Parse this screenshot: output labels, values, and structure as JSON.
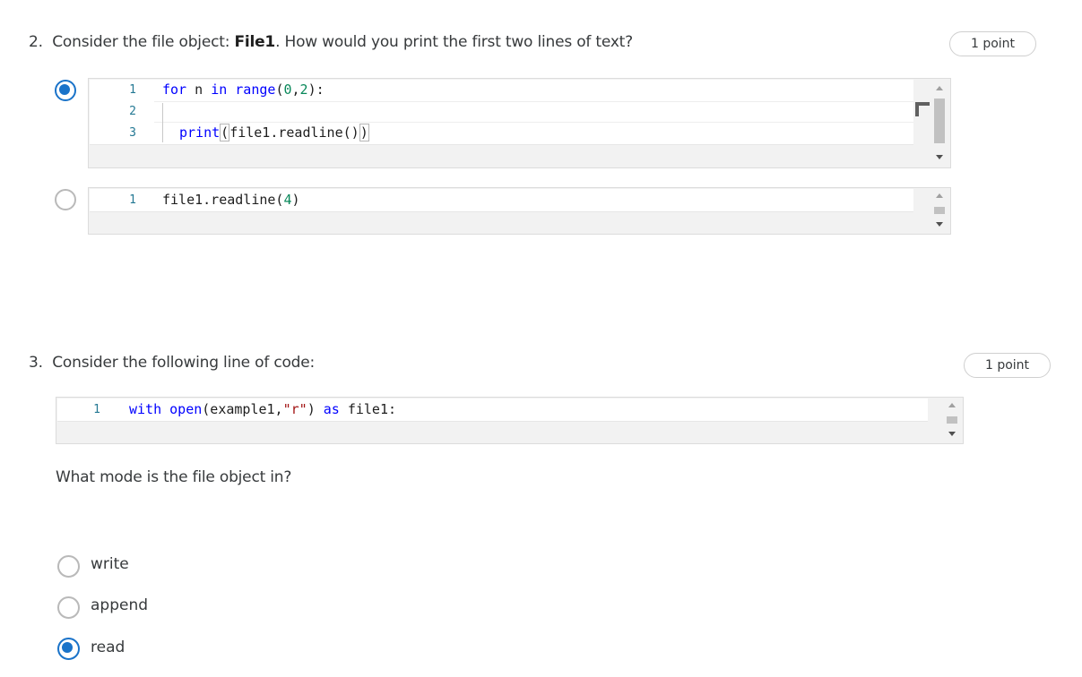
{
  "q2": {
    "number": "2.",
    "text_before": "Consider the file object: ",
    "text_bold": "File1",
    "text_after": ". How would you print the first two lines of text?",
    "points": "1 point",
    "options": [
      {
        "selected": true,
        "lines": [
          {
            "num": "1"
          },
          {
            "num": "2"
          },
          {
            "num": "3"
          }
        ]
      },
      {
        "selected": false,
        "lines": [
          {
            "num": "1"
          }
        ]
      }
    ]
  },
  "q3": {
    "number": "3.",
    "text": "Consider the following line of code:",
    "points": "1 point",
    "code_line_num": "1",
    "followup": "What mode is the file object in?",
    "options": [
      {
        "label": "write",
        "selected": false
      },
      {
        "label": "append",
        "selected": false
      },
      {
        "label": "read",
        "selected": true
      }
    ]
  },
  "code": {
    "q2_opt1_line1": "for n in range(0,2):",
    "q2_opt1_line3": "print(file1.readline())",
    "q2_opt2_line1": "file1.readline(4)",
    "q3_line1": "with open(example1,\"r\") as file1:"
  },
  "colors": {
    "accent": "#1a73c9",
    "keyword": "#0000ff",
    "number": "#09885a",
    "string": "#a31515"
  }
}
